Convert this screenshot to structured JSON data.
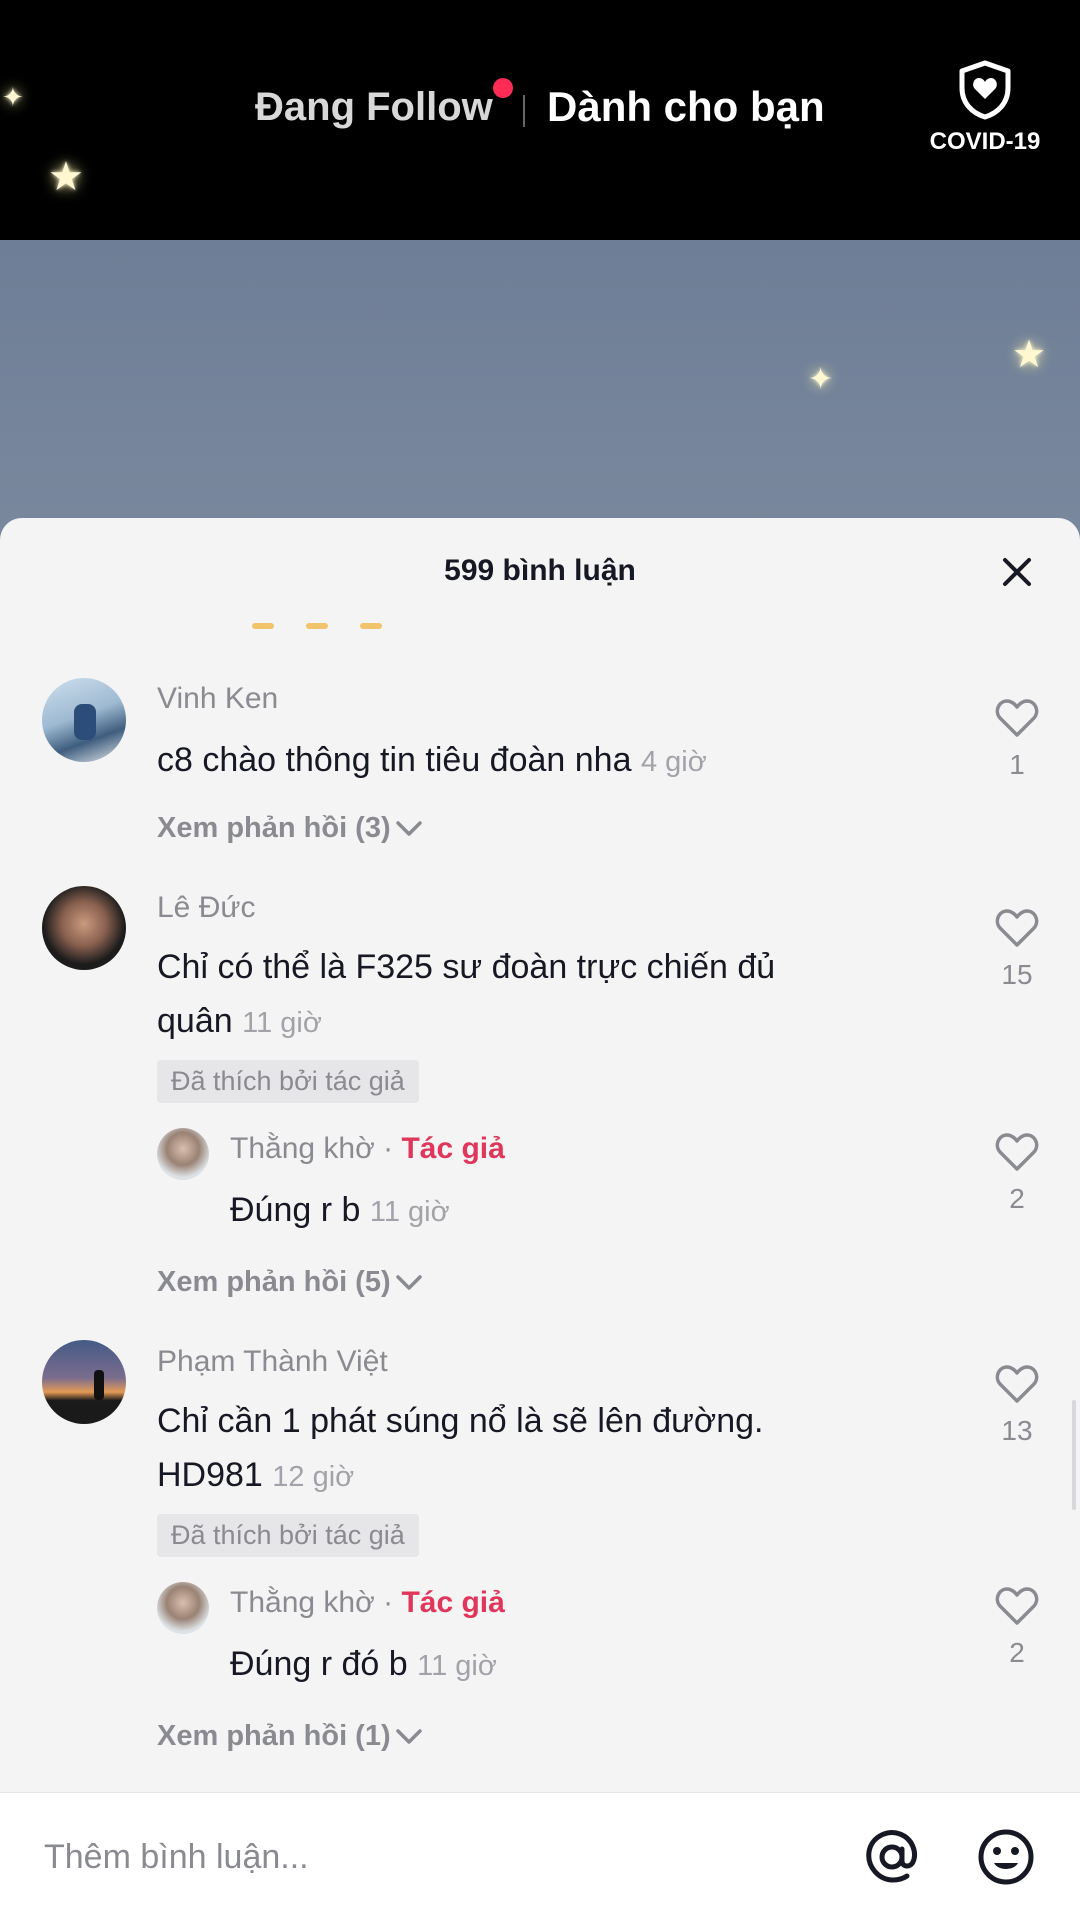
{
  "header": {
    "tab_following": "Đang Follow",
    "tab_for_you": "Dành cho bạn",
    "covid_label": "COVID-19"
  },
  "comments_sheet": {
    "title": "599 bình luận",
    "input_placeholder": "Thêm bình luận...",
    "comments": [
      {
        "username": "Vinh Ken",
        "text": "c8 chào thông tin tiêu đoàn nha",
        "time": "4 giờ",
        "likes": "1",
        "view_replies": "Xem phản hồi (3)"
      },
      {
        "username": "Lê Đức",
        "text_line1": "Chỉ có thể là F325 sư đoàn trực chiến đủ",
        "text_line2": "quân",
        "time": "11 giờ",
        "likes": "15",
        "liked_by_author": "Đã thích bởi tác giả",
        "reply": {
          "username": "Thằng khờ",
          "separator": "·",
          "author_tag": "Tác giả",
          "text": "Đúng r b",
          "time": "11 giờ",
          "likes": "2"
        },
        "view_replies": "Xem phản hồi (5)"
      },
      {
        "username": "Phạm Thành Việt",
        "text_line1": "Chỉ cần 1 phát súng nổ là sẽ lên đường.",
        "text_line2": "HD981",
        "time": "12 giờ",
        "likes": "13",
        "liked_by_author": "Đã thích bởi tác giả",
        "reply": {
          "username": "Thằng khờ",
          "separator": "·",
          "author_tag": "Tác giả",
          "text": "Đúng r đó b",
          "time": "11 giờ",
          "likes": "2"
        },
        "view_replies": "Xem phản hồi (1)"
      }
    ]
  },
  "colors": {
    "accent": "#fe2c55",
    "author_tag": "#e0365b",
    "sheet_bg": "#f5f4f5"
  },
  "icons": [
    "shield-heart-icon",
    "close-icon",
    "heart-outline-icon",
    "chevron-down-icon",
    "at-mention-icon",
    "emoji-icon"
  ]
}
